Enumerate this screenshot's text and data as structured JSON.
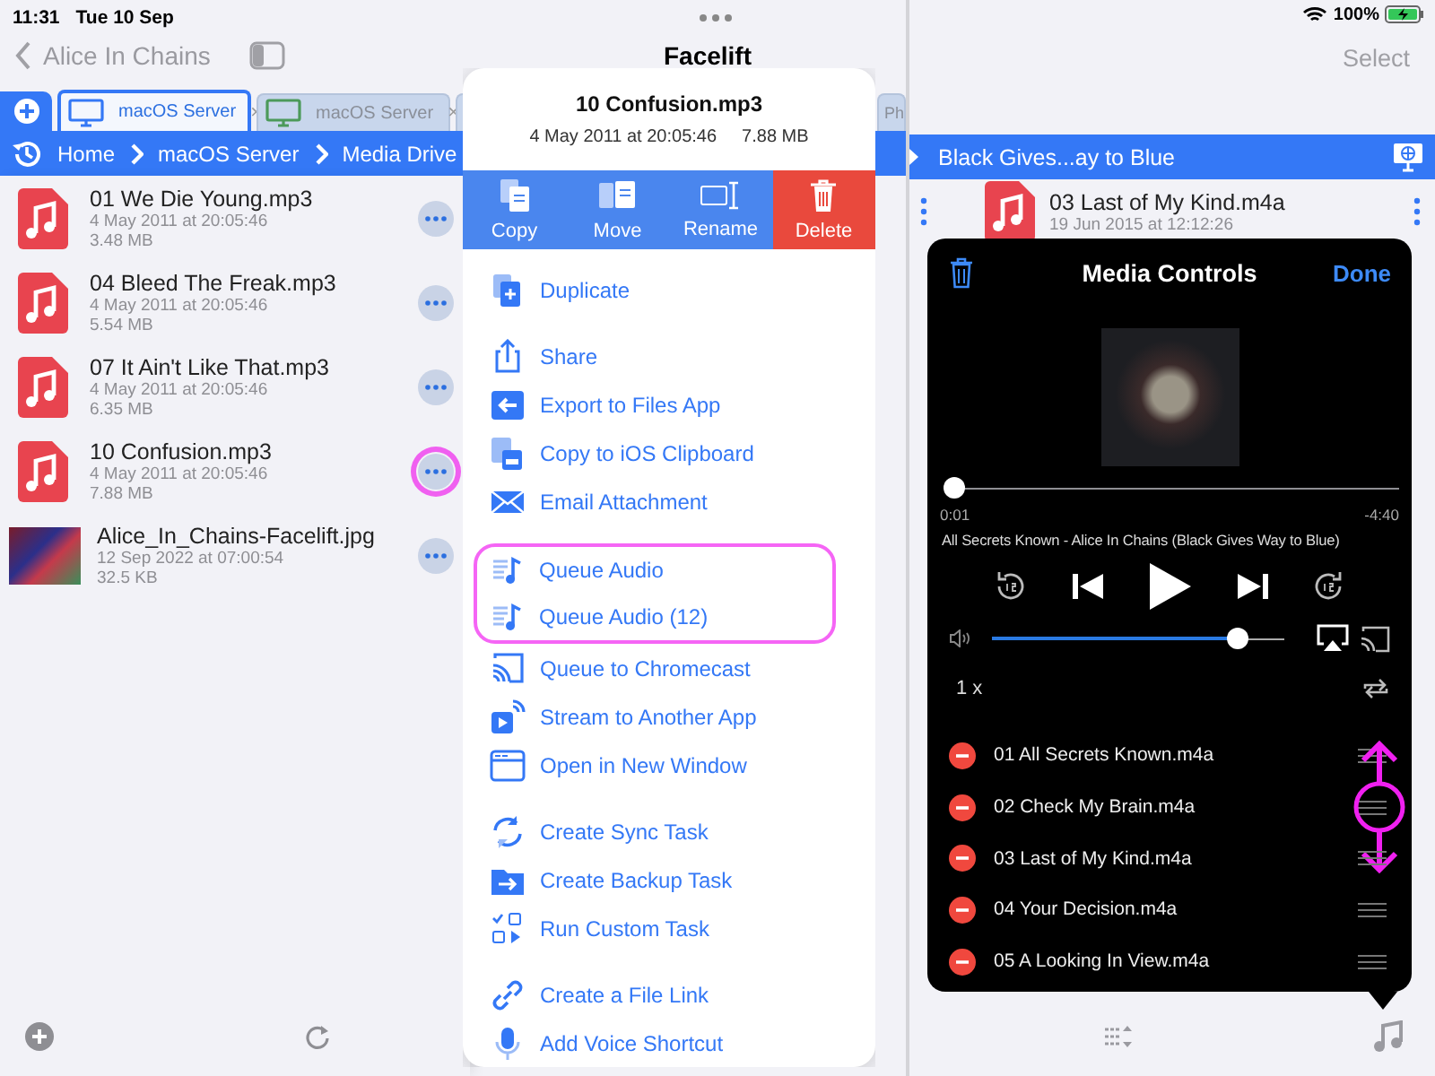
{
  "left_status": {
    "time": "11:31",
    "date": "Tue 10 Sep"
  },
  "left_nav": {
    "back": "Alice In Chains",
    "title": "Facelift"
  },
  "tabs": [
    {
      "label": "macOS Server",
      "selected": true,
      "close": "×"
    },
    {
      "label": "macOS Server",
      "selected": false,
      "close": "×"
    },
    {
      "selected": false
    },
    {
      "label": "Ph",
      "selected": false
    }
  ],
  "breadcrumbs": [
    "Home",
    "macOS Server",
    "Media Drive"
  ],
  "files": [
    {
      "kind": "audio",
      "name": "01 We Die Young.mp3",
      "date": "4 May 2011 at 20:05:46",
      "size": "3.48 MB",
      "highlighted": false
    },
    {
      "kind": "audio",
      "name": "04 Bleed The Freak.mp3",
      "date": "4 May 2011 at 20:05:46",
      "size": "5.54 MB",
      "highlighted": false
    },
    {
      "kind": "audio",
      "name": "07 It Ain't Like That.mp3",
      "date": "4 May 2011 at 20:05:46",
      "size": "6.35 MB",
      "highlighted": false
    },
    {
      "kind": "audio",
      "name": "10 Confusion.mp3",
      "date": "4 May 2011 at 20:05:46",
      "size": "7.88 MB",
      "highlighted": true
    },
    {
      "kind": "image",
      "name": "Alice_In_Chains-Facelift.jpg",
      "date": "12 Sep 2022 at 07:00:54",
      "size": "32.5 KB",
      "highlighted": false
    }
  ],
  "popover": {
    "title": "10 Confusion.mp3",
    "date": "4 May 2011 at 20:05:46",
    "size": "7.88 MB",
    "actions": [
      {
        "kind": "copy",
        "label": "Copy"
      },
      {
        "kind": "move",
        "label": "Move"
      },
      {
        "kind": "rename",
        "label": "Rename"
      },
      {
        "kind": "delete",
        "label": "Delete"
      }
    ],
    "sections": [
      [
        {
          "kind": "duplicate",
          "label": "Duplicate",
          "highlighted": false
        }
      ],
      [
        {
          "kind": "share",
          "label": "Share",
          "highlighted": false
        },
        {
          "kind": "export",
          "label": "Export to Files App",
          "highlighted": false
        },
        {
          "kind": "clipboard",
          "label": "Copy to iOS Clipboard",
          "highlighted": false
        },
        {
          "kind": "email",
          "label": "Email Attachment",
          "highlighted": false
        }
      ],
      [
        {
          "kind": "queue",
          "label": "Queue Audio",
          "highlighted": true
        },
        {
          "kind": "queue",
          "label": "Queue Audio (12)",
          "highlighted": true
        },
        {
          "kind": "cast",
          "label": "Queue to Chromecast",
          "highlighted": false
        },
        {
          "kind": "stream",
          "label": "Stream to Another App",
          "highlighted": false
        },
        {
          "kind": "window",
          "label": "Open in New Window",
          "highlighted": false
        }
      ],
      [
        {
          "kind": "sync",
          "label": "Create Sync Task",
          "highlighted": false
        },
        {
          "kind": "backup",
          "label": "Create Backup Task",
          "highlighted": false
        },
        {
          "kind": "task",
          "label": "Run Custom Task",
          "highlighted": false
        }
      ],
      [
        {
          "kind": "link",
          "label": "Create a File Link",
          "highlighted": false
        },
        {
          "kind": "voice",
          "label": "Add Voice Shortcut",
          "highlighted": false
        }
      ]
    ]
  },
  "right_status": {
    "battery": "100%"
  },
  "right_nav": {
    "action": "Select"
  },
  "folder_bar": {
    "title": "Black Gives...ay to Blue"
  },
  "right_files": [
    {
      "name": "03 Last of My Kind.m4a",
      "date": "19 Jun 2015 at 12:12:26"
    }
  ],
  "media": {
    "title": "Media Controls",
    "done": "Done",
    "position": {
      "level": 0.005
    },
    "elapsed": "0:01",
    "remaining": "-4:40",
    "now_playing": "All Secrets Known - Alice In Chains (Black Gives Way to Blue)",
    "playing": false,
    "volume": {
      "level": 0.84
    },
    "speed": "1 x",
    "queue": [
      {
        "name": "01 All Secrets Known.m4a",
        "highlighted": false
      },
      {
        "name": "02 Check My Brain.m4a",
        "highlighted": true
      },
      {
        "name": "03 Last of My Kind.m4a",
        "highlighted": false
      },
      {
        "name": "04 Your Decision.m4a",
        "highlighted": false
      },
      {
        "name": "05 A Looking In View.m4a",
        "highlighted": false
      }
    ]
  }
}
